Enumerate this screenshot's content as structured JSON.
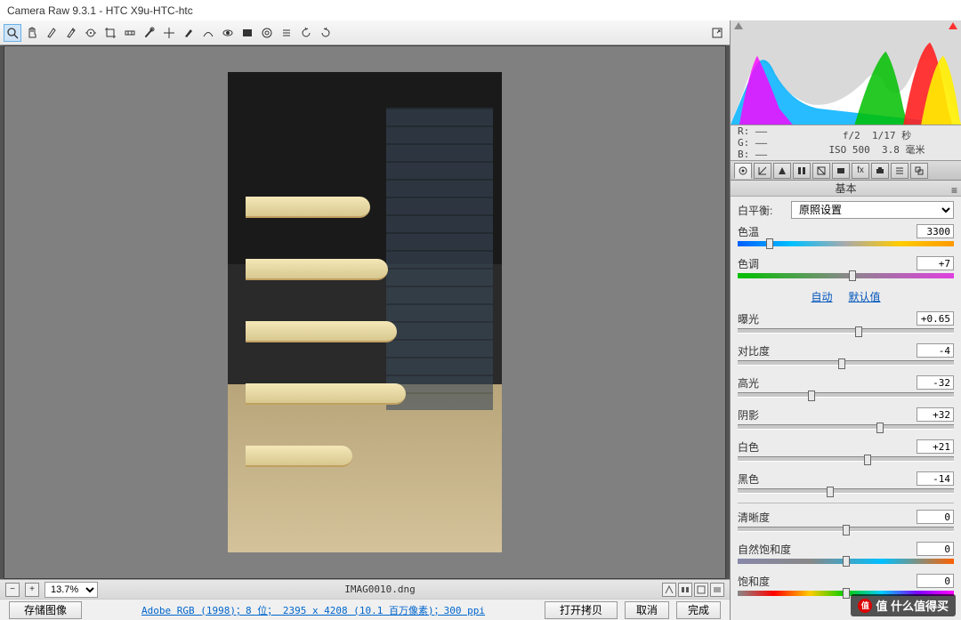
{
  "title": "Camera Raw 9.3.1  -  HTC X9u-HTC-htc",
  "toolbar": {
    "icons": [
      "zoom-icon",
      "hand-icon",
      "white-balance-icon",
      "color-sampler-icon",
      "target-adjust-icon",
      "crop-icon",
      "straighten-icon",
      "spot-removal-icon",
      "redeye-icon",
      "adjustment-brush-icon",
      "graduated-filter-icon",
      "radial-filter-icon",
      "eye-icon",
      "lens-icon",
      "rotate-ccw-icon",
      "rotate-cw-icon"
    ],
    "fullscreen_icon": "fullscreen-icon"
  },
  "status": {
    "zoom": "13.7%",
    "filename": "IMAG0010.dng"
  },
  "footer": {
    "save_label": "存储图像",
    "info_link": "Adobe RGB (1998)；8 位；  2395 x 4208 (10.1 百万像素)；300 ppi",
    "open_label": "打开拷贝",
    "cancel_label": "取消",
    "done_label": "完成"
  },
  "histogram": {
    "rgb": {
      "R": "——",
      "G": "——",
      "B": "——"
    },
    "exif": {
      "aperture": "f/2",
      "shutter": "1/17 秒",
      "iso": "ISO 500",
      "focal": "3.8 毫米"
    }
  },
  "panel": {
    "header": "基本",
    "wb_label": "白平衡:",
    "wb_value": "原照设置",
    "auto_label": "自动",
    "default_label": "默认值",
    "sliders": {
      "temp": {
        "label": "色温",
        "value": "3300",
        "pos": 15
      },
      "tint": {
        "label": "色调",
        "value": "+7",
        "pos": 53
      },
      "exposure": {
        "label": "曝光",
        "value": "+0.65",
        "pos": 56
      },
      "contrast": {
        "label": "对比度",
        "value": "-4",
        "pos": 48
      },
      "highlights": {
        "label": "高光",
        "value": "-32",
        "pos": 34
      },
      "shadows": {
        "label": "阴影",
        "value": "+32",
        "pos": 66
      },
      "whites": {
        "label": "白色",
        "value": "+21",
        "pos": 60
      },
      "blacks": {
        "label": "黑色",
        "value": "-14",
        "pos": 43
      },
      "clarity": {
        "label": "清晰度",
        "value": "0",
        "pos": 50
      },
      "vibrance": {
        "label": "自然饱和度",
        "value": "0",
        "pos": 50
      },
      "saturation": {
        "label": "饱和度",
        "value": "0",
        "pos": 50
      }
    }
  },
  "watermark": "值  什么值得买"
}
